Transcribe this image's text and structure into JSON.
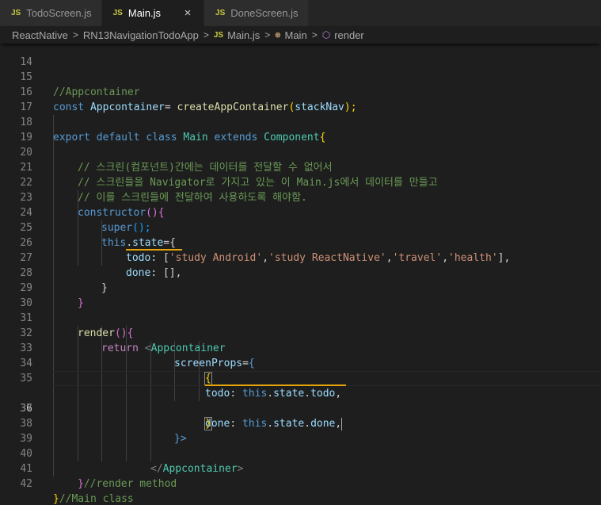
{
  "tabs": [
    {
      "icon": "JS",
      "label": "TodoScreen.js",
      "active": false
    },
    {
      "icon": "JS",
      "label": "Main.js",
      "active": true,
      "close": "×"
    },
    {
      "icon": "JS",
      "label": "DoneScreen.js",
      "active": false
    }
  ],
  "breadcrumb": {
    "items": [
      "ReactNative",
      "RN13NavigationTodoApp",
      "Main.js",
      "Main",
      "render"
    ],
    "file_icon": "JS",
    "separator": ">"
  },
  "colors": {
    "background": "#1e1e1e",
    "comment": "#6a9955",
    "keyword": "#569cd6",
    "variable": "#9cdcfe",
    "function": "#dcdcaa",
    "class": "#4ec9b0",
    "string": "#ce9178",
    "warning_squiggle": "#e5a50a"
  },
  "editor": {
    "line_numbers": [
      "14",
      "15",
      "16",
      "17",
      "18",
      "19",
      "20",
      "21",
      "22",
      "23",
      "24",
      "25",
      "26",
      "27",
      "28",
      "29",
      "30",
      "31",
      "32",
      "33",
      "34",
      "35",
      "36",
      "37",
      "38",
      "39",
      "40",
      "41",
      "42"
    ],
    "lines": {
      "l15": {
        "t1": "//Appcontainer"
      },
      "l16": {
        "t1": "const",
        "t2": " Appcontainer",
        "t3": "= ",
        "t4": "createAppContainer",
        "t5": "(",
        "t6": "stackNav",
        "t7": ");"
      },
      "l18": {
        "t1": "export default class",
        "t2": " Main ",
        "t3": "extends",
        "t4": " Component",
        "t5": "{"
      },
      "l20": {
        "t1": "// 스크린(컴포넌트)간에는 데이터를 전달할 수 없어서"
      },
      "l21": {
        "t1": "// 스크린들을 Navigator로 가지고 있는 이 Main.js에서 데이터를 만들고"
      },
      "l22": {
        "t1": "// 이를 스크린들에 전달하여 사용하도록 해야함."
      },
      "l23": {
        "t1": "constructor",
        "t2": "(){"
      },
      "l24": {
        "t1": "super",
        "t2": "();"
      },
      "l25": {
        "t1": "this",
        "t2": ".",
        "t3": "state",
        "t4": "={"
      },
      "l26": {
        "t1": "todo",
        "t2": ": [",
        "t3": "'study Android'",
        "t4": ",",
        "t5": "'study ReactNative'",
        "t6": ",",
        "t7": "'travel'",
        "t8": ",",
        "t9": "'health'",
        "t10": "],"
      },
      "l27": {
        "t1": "done",
        "t2": ": [],"
      },
      "l28": {
        "t1": "}"
      },
      "l29": {
        "t1": "}"
      },
      "l31": {
        "t1": "render",
        "t2": "(){"
      },
      "l32": {
        "t1": "return",
        "t2": " <",
        "t3": "Appcontainer"
      },
      "l33": {
        "t1": "screenProps",
        "t2": "=",
        "t3": "{"
      },
      "l34": {
        "t1": "{"
      },
      "l35": {
        "t1": "todo",
        "t2": ": ",
        "t3": "this",
        "t4": ".",
        "t5": "state",
        "t6": ".",
        "t7": "todo",
        "t8": ","
      },
      "l36": {
        "t1": "done",
        "t2": ": ",
        "t3": "this",
        "t4": ".",
        "t5": "state",
        "t6": ".",
        "t7": "done",
        "t8": ","
      },
      "l37": {
        "t1": "}"
      },
      "l38": {
        "t1": "}>"
      },
      "l40": {
        "t1": "</",
        "t2": "Appcontainer",
        "t3": ">"
      },
      "l41": {
        "t1": "}",
        "t2": "//render method"
      },
      "l42": {
        "t1": "}",
        "t2": "//Main class"
      }
    }
  }
}
